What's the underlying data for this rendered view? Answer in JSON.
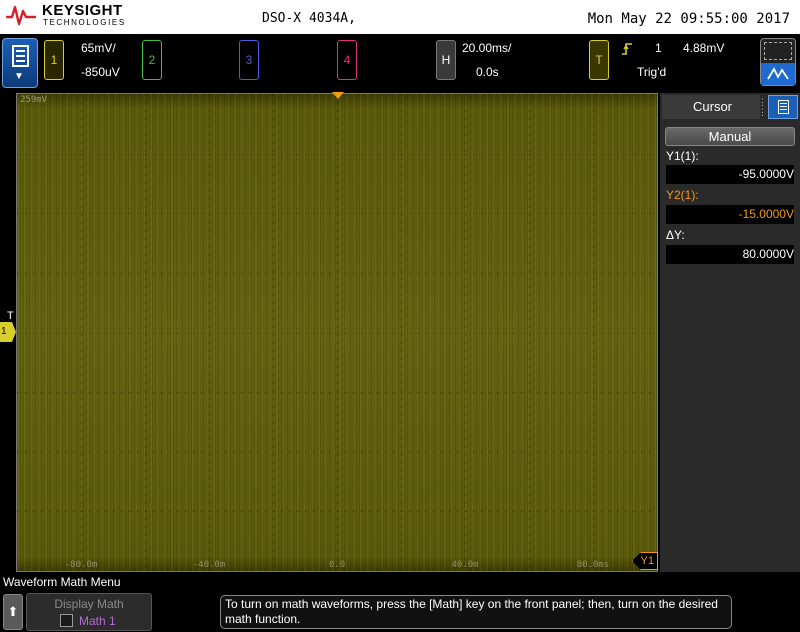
{
  "titlebar": {
    "brand": "KEYSIGHT",
    "brand_sub": "TECHNOLOGIES",
    "model": "DSO-X 4034A,",
    "datetime": "Mon May 22 09:55:00 2017"
  },
  "channels": {
    "ch1": {
      "label": "1",
      "scale": "65mV/",
      "offset": "-850uV",
      "color": "#d7cf2e"
    },
    "ch2": {
      "label": "2",
      "color": "#3fbf3f"
    },
    "ch3": {
      "label": "3",
      "color": "#4a5fe0"
    },
    "ch4": {
      "label": "4",
      "color": "#e03080"
    }
  },
  "horizontal": {
    "button_label": "H",
    "timebase": "20.00ms/",
    "delay": "0.0s"
  },
  "trigger": {
    "button_label": "T",
    "source": "1",
    "level": "4.88mV",
    "status": "Trig'd"
  },
  "display": {
    "y_top_label": "259mV",
    "x_tick_labels": [
      "-80.0m",
      "-40.0m",
      "0.0",
      "40.0m",
      "80.0ms"
    ],
    "trigger_level_label": "T",
    "ground_marker_label": "1",
    "cursor_marker_label": "Y1"
  },
  "cursor_panel": {
    "tab_label": "Cursor",
    "mode_button": "Manual",
    "y1_label": "Y1(1):",
    "y1_value": "-95.0000V",
    "y2_label": "Y2(1):",
    "y2_value": "-15.0000V",
    "delta_label": "ΔY:",
    "delta_value": "80.0000V"
  },
  "bottom": {
    "menu_title": "Waveform Math Menu",
    "softkey_title": "Display Math",
    "softkey_option": "Math 1",
    "softkey_checked": false,
    "help_text": "To turn on math waveforms, press the [Math] key on the front panel; then, turn on the desired math function."
  }
}
